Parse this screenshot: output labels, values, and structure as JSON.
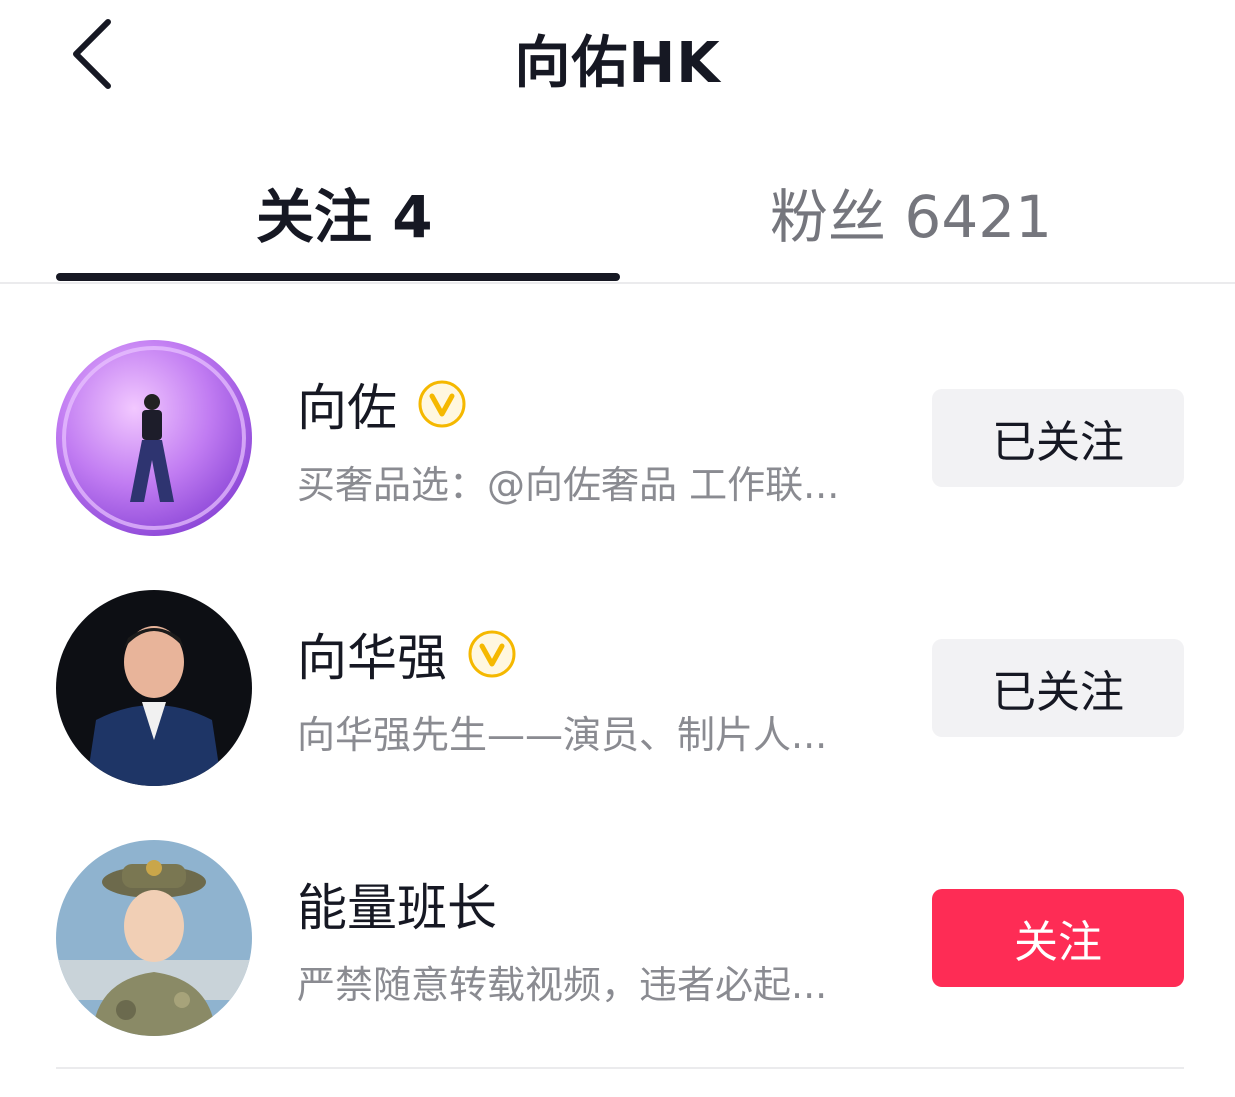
{
  "header": {
    "title": "向佑HK",
    "back_icon": "chevron-left-icon"
  },
  "tabs": [
    {
      "label": "关注 4",
      "active": true
    },
    {
      "label": "粉丝 6421",
      "active": false
    }
  ],
  "users": [
    {
      "name": "向佐",
      "verified": true,
      "description": "买奢品选：@向佐奢品  工作联...",
      "button_label": "已关注",
      "following": true
    },
    {
      "name": "向华强",
      "verified": true,
      "description": "向华强先生——演员、制片人...",
      "button_label": "已关注",
      "following": true
    },
    {
      "name": "能量班长",
      "verified": false,
      "description": "严禁随意转载视频，违者必起...",
      "button_label": "关注",
      "following": false
    }
  ],
  "colors": {
    "accent": "#fe2c55",
    "verified_badge": "#f5b800",
    "text_primary": "#161823",
    "text_secondary": "#8a8b91"
  }
}
